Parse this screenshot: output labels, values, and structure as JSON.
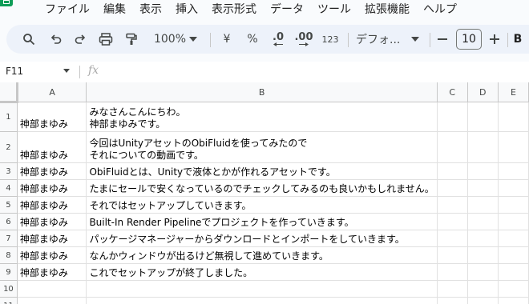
{
  "menu": {
    "items": [
      "ファイル",
      "編集",
      "表示",
      "挿入",
      "表示形式",
      "データ",
      "ツール",
      "拡張機能",
      "ヘルプ"
    ]
  },
  "toolbar": {
    "zoom": "100%",
    "currency": "¥",
    "percent": "%",
    "decimal_decrease": ".0",
    "decimal_increase": ".00",
    "number_format": "123",
    "font": "デフォ...",
    "font_size": "10",
    "bold": "B"
  },
  "formula_bar": {
    "cell_ref": "F11",
    "fx": "fx"
  },
  "grid": {
    "columns": [
      "A",
      "B",
      "C",
      "D",
      "E"
    ],
    "rows": [
      {
        "num": "1",
        "a": "神部まゆみ",
        "b": "みなさんこんにちわ。\n神部まゆみです。"
      },
      {
        "num": "2",
        "a": "神部まゆみ",
        "b": "今回はUnityアセットのObiFluidを使ってみたので\nそれについての動画です。"
      },
      {
        "num": "3",
        "a": "神部まゆみ",
        "b": "ObiFluidとは、Unityで液体とかが作れるアセットです。"
      },
      {
        "num": "4",
        "a": "神部まゆみ",
        "b": "たまにセールで安くなっているのでチェックしてみるのも良いかもしれません。"
      },
      {
        "num": "5",
        "a": "神部まゆみ",
        "b": "それではセットアップしていきます。"
      },
      {
        "num": "6",
        "a": "神部まゆみ",
        "b": "Built-In Render Pipelineでプロジェクトを作っていきます。"
      },
      {
        "num": "7",
        "a": "神部まゆみ",
        "b": "パッケージマネージャーからダウンロードとインポートをしていきます。"
      },
      {
        "num": "8",
        "a": "神部まゆみ",
        "b": "なんかウィンドウが出るけど無視して進めていきます。"
      },
      {
        "num": "9",
        "a": "神部まゆみ",
        "b": "これでセットアップが終了しました。"
      },
      {
        "num": "10",
        "a": "",
        "b": ""
      },
      {
        "num": "11",
        "a": "",
        "b": ""
      }
    ]
  }
}
